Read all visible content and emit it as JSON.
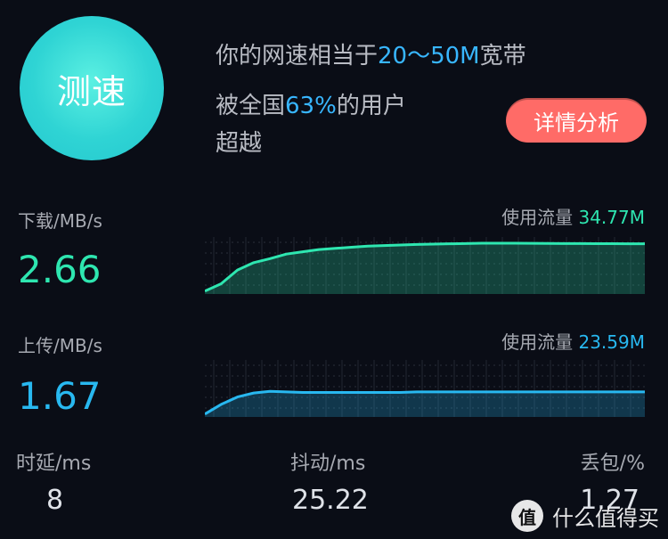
{
  "speed_button": {
    "label": "测速"
  },
  "summary": {
    "line1_prefix": "你的网速相当于",
    "line1_highlight": "20～50M",
    "line1_suffix": "宽带",
    "line2_prefix": "被全国",
    "line2_highlight": "63%",
    "line2_suffix": "的用户",
    "line3": "超越"
  },
  "detail_button": {
    "label": "详情分析"
  },
  "download": {
    "label": "下载/MB/s",
    "value": "2.66",
    "traffic_label": "使用流量",
    "traffic_value": "34.77M",
    "color": "#2ee6b0",
    "curve": [
      0.05,
      0.18,
      0.42,
      0.55,
      0.62,
      0.7,
      0.74,
      0.78,
      0.8,
      0.82,
      0.84,
      0.85,
      0.86,
      0.87,
      0.875,
      0.88,
      0.885,
      0.89,
      0.89,
      0.89,
      0.888,
      0.886,
      0.885,
      0.884,
      0.883,
      0.882,
      0.881,
      0.88
    ]
  },
  "upload": {
    "label": "上传/MB/s",
    "value": "1.67",
    "traffic_label": "使用流量",
    "traffic_value": "23.59M",
    "color": "#28b8f0",
    "curve": [
      0.05,
      0.22,
      0.35,
      0.42,
      0.45,
      0.44,
      0.43,
      0.43,
      0.43,
      0.43,
      0.43,
      0.43,
      0.43,
      0.44,
      0.44,
      0.44,
      0.44,
      0.44,
      0.44,
      0.44,
      0.44,
      0.44,
      0.44,
      0.44,
      0.44,
      0.44,
      0.44,
      0.44
    ]
  },
  "footer": {
    "latency_label": "时延/ms",
    "latency_value": "8",
    "jitter_label": "抖动/ms",
    "jitter_value": "25.22",
    "loss_label": "丢包/%",
    "loss_value": "1.27"
  },
  "watermark": {
    "badge": "值",
    "text": "什么值得买"
  }
}
